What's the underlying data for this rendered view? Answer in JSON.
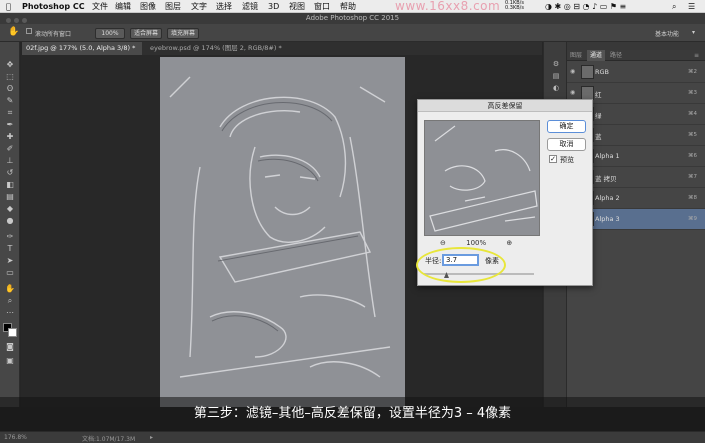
{
  "menubar": {
    "app": "Photoshop CC",
    "items": [
      "文件",
      "编辑",
      "图像",
      "图层",
      "文字",
      "选择",
      "滤镜",
      "3D",
      "视图",
      "窗口",
      "帮助"
    ],
    "watermark": "www.16xx8.com",
    "status": {
      "net_up": "0.1KB/s",
      "net_down": "0.3KB/s"
    }
  },
  "window": {
    "title": "Adobe Photoshop CC 2015"
  },
  "options": {
    "scroll_all_label": "滚动所有窗口",
    "zoom_value": "100%",
    "fit_screen_label": "适合屏幕",
    "fill_screen_label": "填充屏幕"
  },
  "workspace": {
    "label": "基本功能"
  },
  "tabs": [
    {
      "label": "02f.jpg @ 177% (5.0, Alpha 3/8) *",
      "active": true
    },
    {
      "label": "eyebrow.psd @ 174% (图层 2, RGB/8#) *",
      "active": false
    }
  ],
  "dialog": {
    "title": "高反差保留",
    "ok_label": "确定",
    "cancel_label": "取消",
    "preview_label": "预览",
    "preview_checked": true,
    "zoom_out_icon": "magnify-minus",
    "zoom_in_icon": "magnify-plus",
    "zoom_value": "100%",
    "radius_label": "半径:",
    "radius_value": "3.7",
    "radius_unit": "像素",
    "slider_position": 0.2
  },
  "panel": {
    "tabs": [
      "图层",
      "通道",
      "路径"
    ],
    "active_tab": "通道",
    "channels": [
      {
        "name": "RGB",
        "shortcut": "⌘2",
        "selected": false
      },
      {
        "name": "红",
        "shortcut": "⌘3",
        "selected": false
      },
      {
        "name": "绿",
        "shortcut": "⌘4",
        "selected": false
      },
      {
        "name": "蓝",
        "shortcut": "⌘5",
        "selected": false
      },
      {
        "name": "Alpha 1",
        "shortcut": "⌘6",
        "selected": false
      },
      {
        "name": "蓝 拷贝",
        "shortcut": "⌘7",
        "selected": false
      },
      {
        "name": "Alpha 2",
        "shortcut": "⌘8",
        "selected": false
      },
      {
        "name": "Alpha 3",
        "shortcut": "⌘9",
        "selected": true
      }
    ]
  },
  "status": {
    "zoom": "176.8%",
    "doc": "文档:1.07M/17.3M"
  },
  "caption": "第三步：滤镜–其他–高反差保留，设置半径为3 – 4像素",
  "colors": {
    "accent": "#596f8f",
    "highlight": "#e8e63a",
    "ok_border": "#5b8ed8"
  }
}
